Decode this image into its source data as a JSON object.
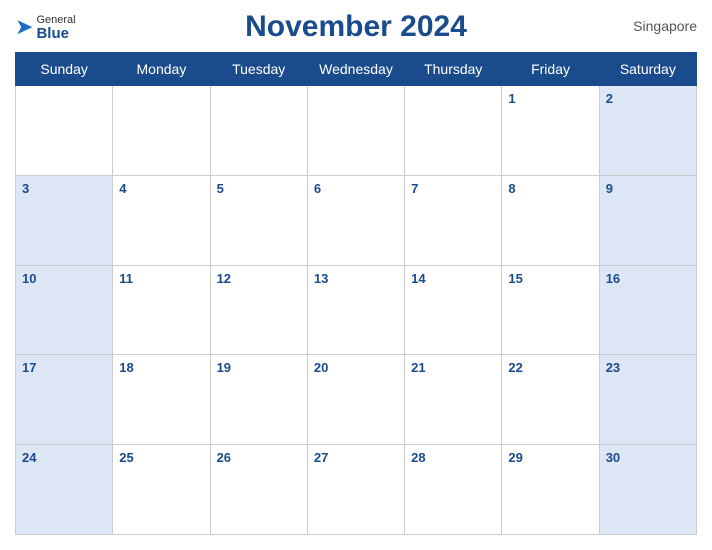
{
  "header": {
    "title": "November 2024",
    "logo_line1": "General",
    "logo_line2": "Blue",
    "country": "Singapore"
  },
  "days": [
    "Sunday",
    "Monday",
    "Tuesday",
    "Wednesday",
    "Thursday",
    "Friday",
    "Saturday"
  ],
  "weeks": [
    [
      null,
      null,
      null,
      null,
      null,
      1,
      2
    ],
    [
      3,
      4,
      5,
      6,
      7,
      8,
      9
    ],
    [
      10,
      11,
      12,
      13,
      14,
      15,
      16
    ],
    [
      17,
      18,
      19,
      20,
      21,
      22,
      23
    ],
    [
      24,
      25,
      26,
      27,
      28,
      29,
      30
    ]
  ]
}
